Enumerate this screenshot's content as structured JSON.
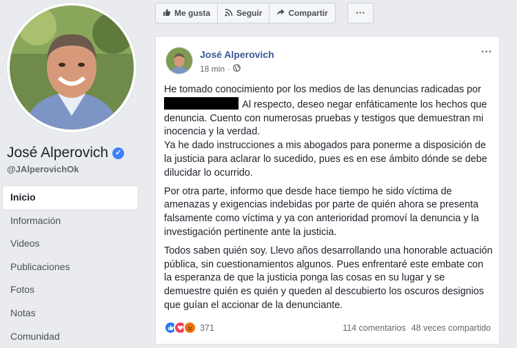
{
  "profile": {
    "name": "José Alperovich",
    "handle": "@JAlperovichOk"
  },
  "nav": [
    {
      "label": "Inicio",
      "active": true
    },
    {
      "label": "Información"
    },
    {
      "label": "Videos"
    },
    {
      "label": "Publicaciones"
    },
    {
      "label": "Fotos"
    },
    {
      "label": "Notas"
    },
    {
      "label": "Comunidad"
    }
  ],
  "actions": {
    "like": "Me gusta",
    "follow": "Seguir",
    "share": "Compartir",
    "more": "···"
  },
  "post": {
    "author": "José Alperovich",
    "time": "18 min",
    "menu": "···",
    "p1_a": "He tomado conocimiento por los medios de las denuncias radicadas por",
    "p1_b": "Al respecto, deseo negar enfáticamente los hechos que denuncia. Cuento con numerosas pruebas y testigos que demuestran mi inocencia y la verdad.",
    "p1_c": "Ya he dado instrucciones a mis abogados para ponerme a disposición de la justicia para aclarar lo sucedido, pues es en ese ámbito dónde se debe dilucidar lo ocurrido.",
    "p2": "Por otra parte, informo que desde hace tiempo he sido víctima de amenazas y exigencias indebidas por parte de quién ahora se presenta falsamente como víctima y ya con anterioridad promoví la denuncia y la investigación pertinente ante la justicia.",
    "p3": "Todos saben quién soy. Llevo años desarrollando una honorable actuación pública, sin cuestionamientos algunos. Pues enfrentaré este embate con la esperanza de que la justicia ponga las cosas en su lugar y se demuestre quién es quién y queden al descubierto los oscuros designios que guían el accionar de la denunciante.",
    "reaction_count": "371",
    "comments": "114 comentarios",
    "shares": "48 veces compartido"
  },
  "colors": {
    "link": "#385898",
    "like": "#2078f4",
    "love": "#f33e58",
    "angry": "#e9710f",
    "verified": "#4080ff"
  }
}
